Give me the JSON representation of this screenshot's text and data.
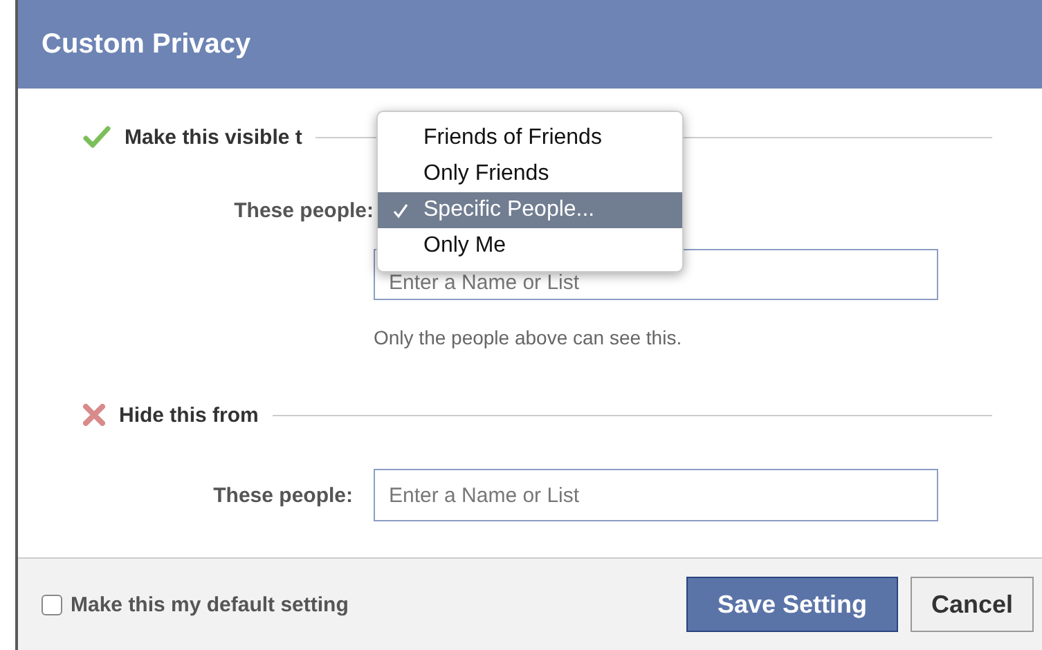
{
  "dialog": {
    "title": "Custom Privacy"
  },
  "sections": [
    {
      "kind": "visible",
      "heading": "Make this visible t",
      "label": "These people:",
      "placeholder": "Enter a Name or List",
      "note": "Only the people above can see this.",
      "menu": [
        {
          "label": "Friends of Friends",
          "selected": false
        },
        {
          "label": "Only Friends",
          "selected": false
        },
        {
          "label": "Specific People...",
          "selected": true
        },
        {
          "label": "Only Me",
          "selected": false
        }
      ]
    },
    {
      "kind": "hide",
      "heading": "Hide this from",
      "label": "These people:",
      "placeholder": "Enter a Name or List"
    }
  ],
  "default_setting": {
    "label": "Make this my default setting",
    "checked": false
  },
  "buttons": [
    {
      "label": "Save Setting",
      "kind": "primary"
    },
    {
      "label": "Cancel",
      "kind": "secondary"
    }
  ]
}
